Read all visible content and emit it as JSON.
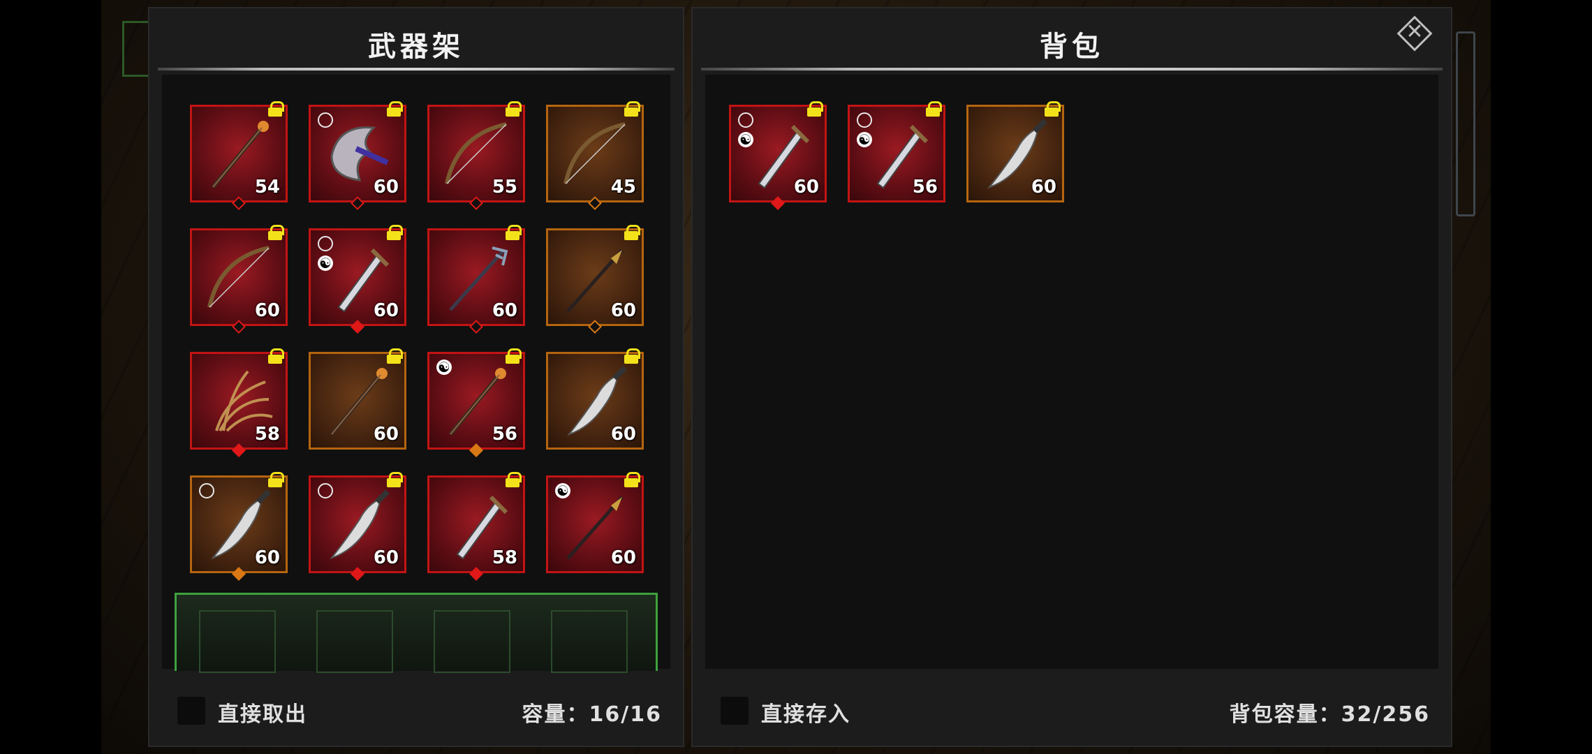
{
  "left_panel": {
    "title": "武器架",
    "footer": {
      "checkbox_label": "直接取出",
      "capacity": "容量：16/16"
    },
    "items": [
      {
        "level": "54",
        "rarity": "red",
        "lock": true,
        "ring": false,
        "yinyang": false,
        "gem": "red-o",
        "icon": "staff-icon"
      },
      {
        "level": "60",
        "rarity": "red",
        "lock": true,
        "ring": true,
        "yinyang": false,
        "gem": "red-o",
        "icon": "axe-icon"
      },
      {
        "level": "55",
        "rarity": "red",
        "lock": true,
        "ring": false,
        "yinyang": false,
        "gem": "red-o",
        "icon": "bow-icon"
      },
      {
        "level": "45",
        "rarity": "orange",
        "lock": true,
        "ring": false,
        "yinyang": false,
        "gem": "orange-o",
        "icon": "bow-icon"
      },
      {
        "level": "60",
        "rarity": "red",
        "lock": true,
        "ring": false,
        "yinyang": false,
        "gem": "red-o",
        "icon": "bow-icon"
      },
      {
        "level": "60",
        "rarity": "red",
        "lock": true,
        "ring": true,
        "yinyang": true,
        "gem": "red-f",
        "icon": "sword-icon"
      },
      {
        "level": "60",
        "rarity": "red",
        "lock": true,
        "ring": false,
        "yinyang": false,
        "gem": "red-o",
        "icon": "trident-icon"
      },
      {
        "level": "60",
        "rarity": "orange",
        "lock": true,
        "ring": false,
        "yinyang": false,
        "gem": "orange-o",
        "icon": "spear-icon"
      },
      {
        "level": "58",
        "rarity": "red",
        "lock": true,
        "ring": false,
        "yinyang": false,
        "gem": "red-f",
        "icon": "claw-icon"
      },
      {
        "level": "60",
        "rarity": "orange",
        "lock": true,
        "ring": false,
        "yinyang": false,
        "gem": "none",
        "icon": "staff-icon"
      },
      {
        "level": "56",
        "rarity": "red",
        "lock": true,
        "ring": false,
        "yinyang": true,
        "gem": "orange-f",
        "icon": "staff-icon"
      },
      {
        "level": "60",
        "rarity": "orange",
        "lock": true,
        "ring": false,
        "yinyang": false,
        "gem": "none",
        "icon": "dagger-icon"
      },
      {
        "level": "60",
        "rarity": "orange",
        "lock": true,
        "ring": true,
        "yinyang": false,
        "gem": "orange-f",
        "icon": "dagger-icon"
      },
      {
        "level": "60",
        "rarity": "red",
        "lock": true,
        "ring": true,
        "yinyang": false,
        "gem": "red-f",
        "icon": "dagger-icon"
      },
      {
        "level": "58",
        "rarity": "red",
        "lock": true,
        "ring": false,
        "yinyang": false,
        "gem": "red-f",
        "icon": "sword-icon"
      },
      {
        "level": "60",
        "rarity": "red",
        "lock": true,
        "ring": false,
        "yinyang": true,
        "gem": "none",
        "icon": "spear-icon"
      }
    ]
  },
  "right_panel": {
    "title": "背包",
    "footer": {
      "checkbox_label": "直接存入",
      "capacity": "背包容量：32/256"
    },
    "items": [
      {
        "level": "60",
        "rarity": "red",
        "lock": true,
        "ring": true,
        "yinyang": true,
        "gem": "red-f",
        "icon": "sword-icon"
      },
      {
        "level": "56",
        "rarity": "red",
        "lock": true,
        "ring": true,
        "yinyang": true,
        "gem": "none",
        "icon": "sword-icon"
      },
      {
        "level": "60",
        "rarity": "orange",
        "lock": true,
        "ring": false,
        "yinyang": false,
        "gem": "none",
        "icon": "dagger-icon"
      }
    ]
  },
  "colors": {
    "rarity_red": "#c21414",
    "rarity_orange": "#b5650f",
    "lock_yellow": "#f3e21a",
    "highlight_green": "#3ea23e"
  }
}
